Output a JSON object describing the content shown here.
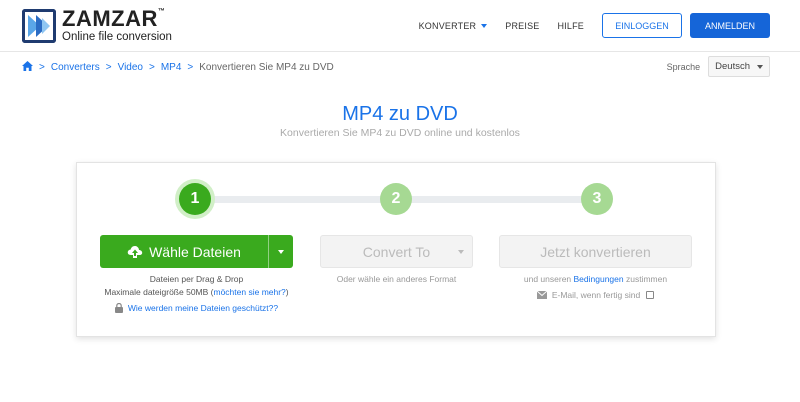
{
  "header": {
    "logo_name": "ZAMZAR",
    "logo_tm": "™",
    "logo_tagline": "Online file conversion",
    "nav": {
      "converters": "KONVERTER",
      "pricing": "PREISE",
      "help": "HILFE"
    },
    "login_label": "EINLOGGEN",
    "signup_label": "ANMELDEN"
  },
  "breadcrumb": {
    "items": [
      "Converters",
      "Video",
      "MP4"
    ],
    "current": "Konvertieren Sie MP4 zu DVD",
    "separator": ">"
  },
  "language": {
    "label": "Sprache",
    "selected": "Deutsch"
  },
  "page": {
    "title": "MP4 zu DVD",
    "subtitle": "Konvertieren Sie MP4 zu DVD online und kostenlos"
  },
  "steps": [
    "1",
    "2",
    "3"
  ],
  "step1": {
    "button_label": "Wähle Dateien",
    "drag_text": "Dateien per Drag & Drop",
    "max_size_prefix": "Maximale dateigröße 50MB (",
    "max_size_link": "möchten sie mehr?",
    "max_size_suffix": ")",
    "protect_link": "Wie werden meine Dateien geschützt??"
  },
  "step2": {
    "select_label": "Convert To",
    "hint": "Oder wähle ein anderes Format"
  },
  "step3": {
    "button_label": "Jetzt konvertieren",
    "terms_prefix": "und unseren ",
    "terms_link": "Bedingungen",
    "terms_suffix": " zustimmen",
    "email_label": "E-Mail, wenn fertig sind"
  },
  "colors": {
    "brand_blue": "#1a73e8",
    "green": "#3aaa1e",
    "green_light": "#a6d993"
  },
  "icons": [
    "home-icon",
    "upload-cloud-icon",
    "lock-icon",
    "envelope-icon"
  ]
}
